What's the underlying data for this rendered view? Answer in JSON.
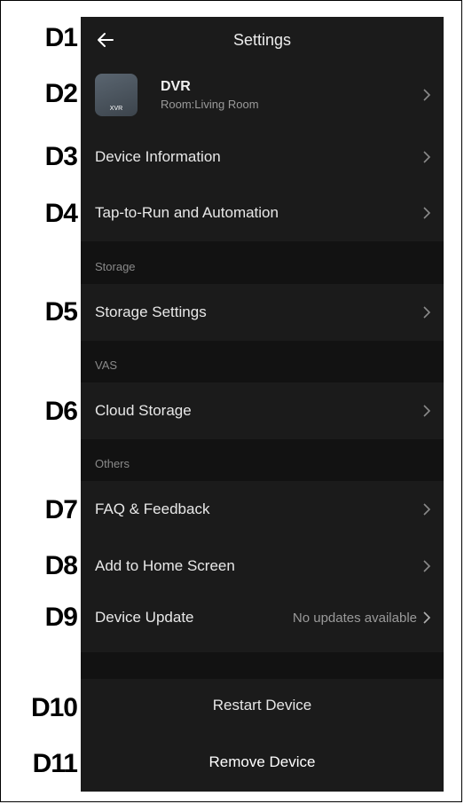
{
  "callouts": [
    "D1",
    "D2",
    "D3",
    "D4",
    "D5",
    "D6",
    "D7",
    "D8",
    "D9",
    "D10",
    "D11"
  ],
  "header": {
    "title": "Settings",
    "back_icon": "arrow-left-icon"
  },
  "device": {
    "name": "DVR",
    "room": "Room:Living Room",
    "thumb_label": "XVR"
  },
  "items": {
    "device_information": "Device Information",
    "tap_to_run": "Tap-to-Run and Automation",
    "storage_settings": "Storage Settings",
    "cloud_storage": "Cloud Storage",
    "faq": "FAQ & Feedback",
    "add_home": "Add to Home Screen",
    "device_update": "Device Update",
    "device_update_value": "No updates available"
  },
  "sections": {
    "storage": "Storage",
    "vas": "VAS",
    "others": "Others"
  },
  "actions": {
    "restart": "Restart Device",
    "remove": "Remove Device"
  },
  "colors": {
    "background": "#1b1b1b",
    "section_bg": "#121212",
    "text": "#e8e8e8",
    "muted": "#9a9a9a"
  }
}
